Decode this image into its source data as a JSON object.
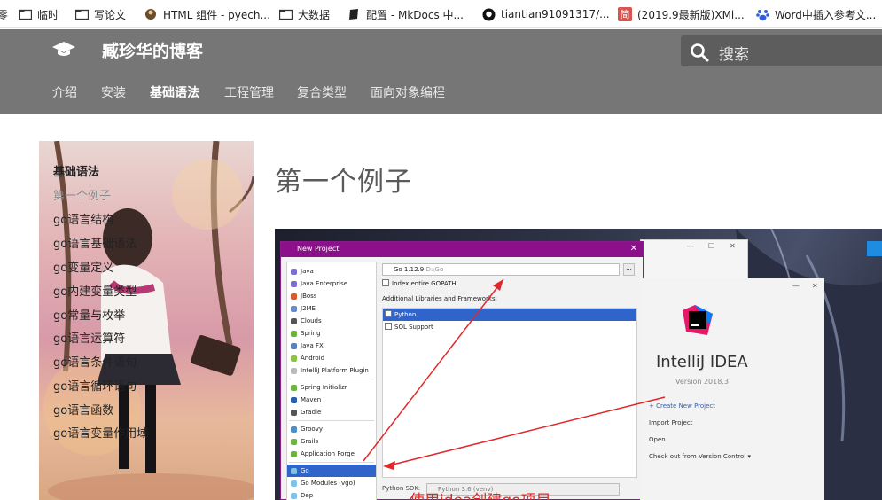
{
  "bookmarks": [
    {
      "label": "零",
      "icon": "folder-icon"
    },
    {
      "label": "临时",
      "icon": "folder-icon"
    },
    {
      "label": "写论文",
      "icon": "folder-icon"
    },
    {
      "label": "HTML 组件 - pyech...",
      "icon": "site-icon"
    },
    {
      "label": "大数据",
      "icon": "folder-icon"
    },
    {
      "label": "配置 - MkDocs 中...",
      "icon": "book-icon"
    },
    {
      "label": "tiantian91091317/...",
      "icon": "github-icon"
    },
    {
      "label": "(2019.9最新版)XMi...",
      "icon": "jian-icon"
    },
    {
      "label": "Word中插入参考文...",
      "icon": "baidu-icon"
    }
  ],
  "header": {
    "site_title": "臧珍华的博客",
    "search_placeholder": "搜索",
    "tabs": [
      {
        "label": "介绍"
      },
      {
        "label": "安装"
      },
      {
        "label": "基础语法",
        "active": true
      },
      {
        "label": "工程管理"
      },
      {
        "label": "复合类型"
      },
      {
        "label": "面向对象编程"
      }
    ]
  },
  "sidebar": {
    "title": "基础语法",
    "items": [
      {
        "label": "第一个例子",
        "active": true
      },
      {
        "label": "go语言结构"
      },
      {
        "label": "go语言基础语法"
      },
      {
        "label": "go变量定义"
      },
      {
        "label": "go内建变量类型"
      },
      {
        "label": "go常量与枚举"
      },
      {
        "label": "go语言运算符"
      },
      {
        "label": "go语言条件语句"
      },
      {
        "label": "go语言循环语句"
      },
      {
        "label": "go语言函数"
      },
      {
        "label": "go语言变量作用域"
      }
    ]
  },
  "main": {
    "page_title": "第一个例子",
    "screenshot": {
      "dialog_title": "New Project",
      "project_types": [
        "Java",
        "Java Enterprise",
        "JBoss",
        "J2ME",
        "Clouds",
        "Spring",
        "Java FX",
        "Android",
        "IntelliJ Platform Plugin",
        "Spring Initializr",
        "Maven",
        "Gradle",
        "Groovy",
        "Grails",
        "Application Forge",
        "Go",
        "Go Modules (vgo)",
        "Dep"
      ],
      "selected_type": "Go",
      "go_sdk": "Go 1.12.9",
      "go_sdk_path": "D:\\Go",
      "index_gopath": "Index entire GOPATH",
      "libraries_label": "Additional Libraries and Frameworks:",
      "frameworks": [
        "Python",
        "SQL Support"
      ],
      "python_sdk_label": "Python SDK:",
      "python_sdk_value": "Python 3.6 (venv)",
      "ide_name": "IntelliJ IDEA",
      "ide_version": "Version 2018.3",
      "ide_actions": [
        "+ Create New Project",
        "Import Project",
        "Open",
        "Check out from Version Control ▾"
      ],
      "caption": "使用idea创建go项目"
    }
  },
  "colors": {
    "header_bg": "#767676",
    "accent_purple": "#8c0f8c",
    "selection_blue": "#2f65ca",
    "arrow_red": "#e0282a"
  }
}
